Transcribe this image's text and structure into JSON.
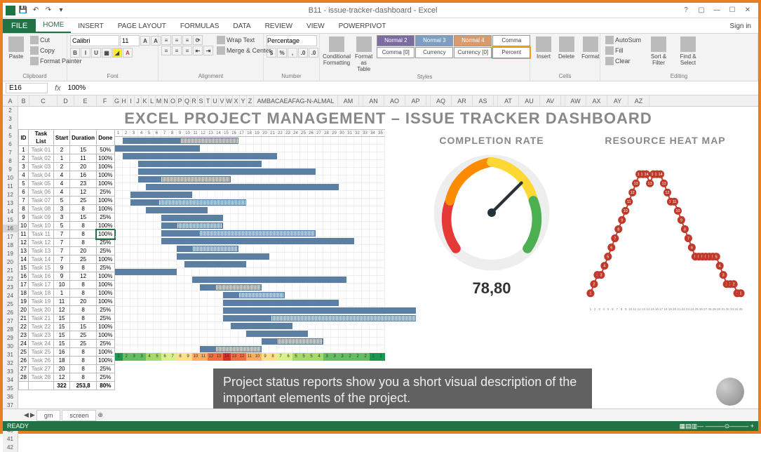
{
  "window": {
    "title": "B11 - issue-tracker-dashboard - Excel"
  },
  "qat": {
    "save": "Save",
    "undo": "Undo",
    "redo": "Redo"
  },
  "tabs": {
    "file": "FILE",
    "home": "HOME",
    "insert": "INSERT",
    "pagelayout": "PAGE LAYOUT",
    "formulas": "FORMULAS",
    "data": "DATA",
    "review": "REVIEW",
    "view": "VIEW",
    "powerpivot": "POWERPIVOT",
    "signin": "Sign in"
  },
  "ribbon": {
    "clipboard": {
      "label": "Clipboard",
      "paste": "Paste",
      "cut": "Cut",
      "copy": "Copy",
      "fmt": "Format Painter"
    },
    "font": {
      "label": "Font",
      "name": "Calibri",
      "size": "11"
    },
    "alignment": {
      "label": "Alignment",
      "wrap": "Wrap Text",
      "merge": "Merge & Center"
    },
    "number": {
      "label": "Number",
      "fmt": "Percentage"
    },
    "styles": {
      "label": "Styles",
      "cond": "Conditional Formatting",
      "astable": "Format as Table",
      "items": [
        "Normal 2",
        "Normal 3",
        "Normal 4",
        "Comma",
        "Comma [0]",
        "Currency",
        "Currency [0]",
        "Percent"
      ]
    },
    "cells": {
      "label": "Cells",
      "insert": "Insert",
      "delete": "Delete",
      "format": "Format"
    },
    "editing": {
      "label": "Editing",
      "sum": "AutoSum",
      "fill": "Fill",
      "clear": "Clear",
      "sort": "Sort & Filter",
      "find": "Find & Select"
    }
  },
  "fbar": {
    "cell": "E16",
    "formula": "100%"
  },
  "columns": [
    "A",
    "B",
    "C",
    "D",
    "E",
    "F",
    "G",
    "H",
    "I",
    "J",
    "K",
    "L",
    "M",
    "N",
    "O",
    "P",
    "Q",
    "R",
    "S",
    "T",
    "U",
    "V",
    "W",
    "X",
    "Y",
    "Z",
    "AMBACAEAFAG-N-ALMAL",
    "AM",
    "",
    "AN",
    "AO",
    "AP",
    "",
    "AQ",
    "AR",
    "AS",
    "",
    "AT",
    "AU",
    "AV",
    "",
    "AW",
    "AX",
    "AY",
    "AZ"
  ],
  "rows_start": 2,
  "rows_end": 42,
  "selected_row": 16,
  "dashboard": {
    "title": "EXCEL PROJECT MANAGEMENT – ISSUE TRACKER DASHBOARD",
    "table_headers": [
      "ID",
      "Task List",
      "Start",
      "Duration",
      "Done"
    ],
    "tasks": [
      {
        "id": 1,
        "name": "Task 01",
        "start": 2,
        "dur": 15,
        "done": "50%"
      },
      {
        "id": 2,
        "name": "Task 02",
        "start": 1,
        "dur": 11,
        "done": "100%"
      },
      {
        "id": 3,
        "name": "Task 03",
        "start": 2,
        "dur": 20,
        "done": "100%"
      },
      {
        "id": 4,
        "name": "Task 04",
        "start": 4,
        "dur": 16,
        "done": "100%"
      },
      {
        "id": 5,
        "name": "Task 05",
        "start": 4,
        "dur": 23,
        "done": "100%"
      },
      {
        "id": 6,
        "name": "Task 06",
        "start": 4,
        "dur": 12,
        "done": "25%"
      },
      {
        "id": 7,
        "name": "Task 07",
        "start": 5,
        "dur": 25,
        "done": "100%"
      },
      {
        "id": 8,
        "name": "Task 08",
        "start": 3,
        "dur": 8,
        "done": "100%"
      },
      {
        "id": 9,
        "name": "Task 09",
        "start": 3,
        "dur": 15,
        "done": "25%"
      },
      {
        "id": 10,
        "name": "Task 10",
        "start": 5,
        "dur": 8,
        "done": "100%"
      },
      {
        "id": 11,
        "name": "Task 11",
        "start": 7,
        "dur": 8,
        "done": "100%"
      },
      {
        "id": 12,
        "name": "Task 12",
        "start": 7,
        "dur": 8,
        "done": "25%"
      },
      {
        "id": 13,
        "name": "Task 13",
        "start": 7,
        "dur": 20,
        "done": "25%"
      },
      {
        "id": 14,
        "name": "Task 14",
        "start": 7,
        "dur": 25,
        "done": "100%"
      },
      {
        "id": 15,
        "name": "Task 15",
        "start": 9,
        "dur": 8,
        "done": "25%"
      },
      {
        "id": 16,
        "name": "Task 16",
        "start": 9,
        "dur": 12,
        "done": "100%"
      },
      {
        "id": 17,
        "name": "Task 17",
        "start": 10,
        "dur": 8,
        "done": "100%"
      },
      {
        "id": 18,
        "name": "Task 18",
        "start": 1,
        "dur": 8,
        "done": "100%"
      },
      {
        "id": 19,
        "name": "Task 19",
        "start": 11,
        "dur": 20,
        "done": "100%"
      },
      {
        "id": 20,
        "name": "Task 20",
        "start": 12,
        "dur": 8,
        "done": "25%"
      },
      {
        "id": 21,
        "name": "Task 21",
        "start": 15,
        "dur": 8,
        "done": "25%"
      },
      {
        "id": 22,
        "name": "Task 22",
        "start": 15,
        "dur": 15,
        "done": "100%"
      },
      {
        "id": 23,
        "name": "Task 23",
        "start": 15,
        "dur": 25,
        "done": "100%"
      },
      {
        "id": 24,
        "name": "Task 24",
        "start": 15,
        "dur": 25,
        "done": "25%"
      },
      {
        "id": 25,
        "name": "Task 25",
        "start": 16,
        "dur": 8,
        "done": "100%"
      },
      {
        "id": 26,
        "name": "Task 26",
        "start": 18,
        "dur": 8,
        "done": "100%"
      },
      {
        "id": 27,
        "name": "Task 27",
        "start": 20,
        "dur": 8,
        "done": "25%"
      },
      {
        "id": 28,
        "name": "Task 28",
        "start": 12,
        "dur": 8,
        "done": "25%"
      }
    ],
    "sum": {
      "items": "322",
      "total": "253,8",
      "pct": "80%"
    },
    "gantt_days": [
      "1",
      "2",
      "3",
      "4",
      "5",
      "6",
      "7",
      "8",
      "9",
      "10",
      "11",
      "12",
      "13",
      "14",
      "15",
      "16",
      "17",
      "18",
      "19",
      "20",
      "21",
      "22",
      "23",
      "24",
      "25",
      "26",
      "27",
      "28",
      "29",
      "30",
      "31",
      "32",
      "33",
      "34",
      "35"
    ],
    "heatband": [
      1,
      2,
      3,
      3,
      4,
      5,
      6,
      7,
      8,
      9,
      10,
      11,
      12,
      13,
      14,
      13,
      12,
      11,
      10,
      9,
      8,
      7,
      6,
      5,
      5,
      5,
      4,
      3,
      3,
      3,
      2,
      2,
      2,
      1,
      1
    ]
  },
  "gauge": {
    "title": "COMPLETION RATE",
    "value": "78,80"
  },
  "heatmap": {
    "title": "RESOURCE HEAT MAP"
  },
  "chart_data": [
    {
      "type": "bar",
      "name": "gantt",
      "categories_axis": "days 1-35",
      "series": [
        {
          "name": "Task 01",
          "start": 2,
          "duration": 15,
          "done_pct": 50
        },
        {
          "name": "Task 02",
          "start": 1,
          "duration": 11,
          "done_pct": 100
        },
        {
          "name": "Task 03",
          "start": 2,
          "duration": 20,
          "done_pct": 100
        },
        {
          "name": "Task 04",
          "start": 4,
          "duration": 16,
          "done_pct": 100
        },
        {
          "name": "Task 05",
          "start": 4,
          "duration": 23,
          "done_pct": 100
        },
        {
          "name": "Task 06",
          "start": 4,
          "duration": 12,
          "done_pct": 25
        },
        {
          "name": "Task 07",
          "start": 5,
          "duration": 25,
          "done_pct": 100
        },
        {
          "name": "Task 08",
          "start": 3,
          "duration": 8,
          "done_pct": 100
        },
        {
          "name": "Task 09",
          "start": 3,
          "duration": 15,
          "done_pct": 25
        },
        {
          "name": "Task 10",
          "start": 5,
          "duration": 8,
          "done_pct": 100
        },
        {
          "name": "Task 11",
          "start": 7,
          "duration": 8,
          "done_pct": 100
        },
        {
          "name": "Task 12",
          "start": 7,
          "duration": 8,
          "done_pct": 25
        },
        {
          "name": "Task 13",
          "start": 7,
          "duration": 20,
          "done_pct": 25
        },
        {
          "name": "Task 14",
          "start": 7,
          "duration": 25,
          "done_pct": 100
        },
        {
          "name": "Task 15",
          "start": 9,
          "duration": 8,
          "done_pct": 25
        },
        {
          "name": "Task 16",
          "start": 9,
          "duration": 12,
          "done_pct": 100
        },
        {
          "name": "Task 17",
          "start": 10,
          "duration": 8,
          "done_pct": 100
        },
        {
          "name": "Task 18",
          "start": 1,
          "duration": 8,
          "done_pct": 100
        },
        {
          "name": "Task 19",
          "start": 11,
          "duration": 20,
          "done_pct": 100
        },
        {
          "name": "Task 20",
          "start": 12,
          "duration": 8,
          "done_pct": 25
        },
        {
          "name": "Task 21",
          "start": 15,
          "duration": 8,
          "done_pct": 25
        },
        {
          "name": "Task 22",
          "start": 15,
          "duration": 15,
          "done_pct": 100
        },
        {
          "name": "Task 23",
          "start": 15,
          "duration": 25,
          "done_pct": 100
        },
        {
          "name": "Task 24",
          "start": 15,
          "duration": 25,
          "done_pct": 25
        },
        {
          "name": "Task 25",
          "start": 16,
          "duration": 8,
          "done_pct": 100
        },
        {
          "name": "Task 26",
          "start": 18,
          "duration": 8,
          "done_pct": 100
        },
        {
          "name": "Task 27",
          "start": 20,
          "duration": 8,
          "done_pct": 25
        },
        {
          "name": "Task 28",
          "start": 12,
          "duration": 8,
          "done_pct": 25
        }
      ]
    },
    {
      "type": "gauge",
      "name": "completion_rate",
      "title": "COMPLETION RATE",
      "value": 78.8,
      "min": 0,
      "max": 100
    },
    {
      "type": "line",
      "name": "resource_heat_map",
      "title": "RESOURCE HEAT MAP",
      "x": [
        1,
        2,
        3,
        4,
        5,
        6,
        7,
        8,
        9,
        10,
        11,
        12,
        13,
        14,
        15,
        16,
        17,
        18,
        19,
        20,
        21,
        22,
        23,
        24,
        25,
        26,
        27,
        28,
        29,
        30,
        31,
        32,
        33,
        34,
        35
      ],
      "values": [
        1,
        2,
        3,
        3,
        4,
        5,
        6,
        7,
        8,
        9,
        10,
        11,
        12,
        13,
        14,
        14,
        14,
        13,
        14,
        14,
        14,
        13,
        12,
        11,
        11,
        10,
        9,
        8,
        7,
        6,
        5,
        5,
        5,
        5,
        5,
        5,
        5,
        4,
        3,
        2,
        2,
        2,
        1,
        1
      ],
      "data_labels": [
        2,
        3,
        4,
        5,
        6,
        7,
        8,
        9,
        10,
        11,
        12,
        13,
        14,
        14,
        14,
        13,
        14,
        14,
        14,
        13,
        12,
        11,
        11,
        10,
        9,
        8,
        7,
        6,
        5,
        5,
        5,
        5,
        5,
        3,
        2,
        2,
        2,
        1,
        1
      ],
      "ylim": [
        0,
        15
      ]
    }
  ],
  "caption": "Project status reports show you a short visual description of the important elements of the project.",
  "sheet_tabs": [
    "gm",
    "screen"
  ],
  "status": {
    "ready": "READY"
  }
}
